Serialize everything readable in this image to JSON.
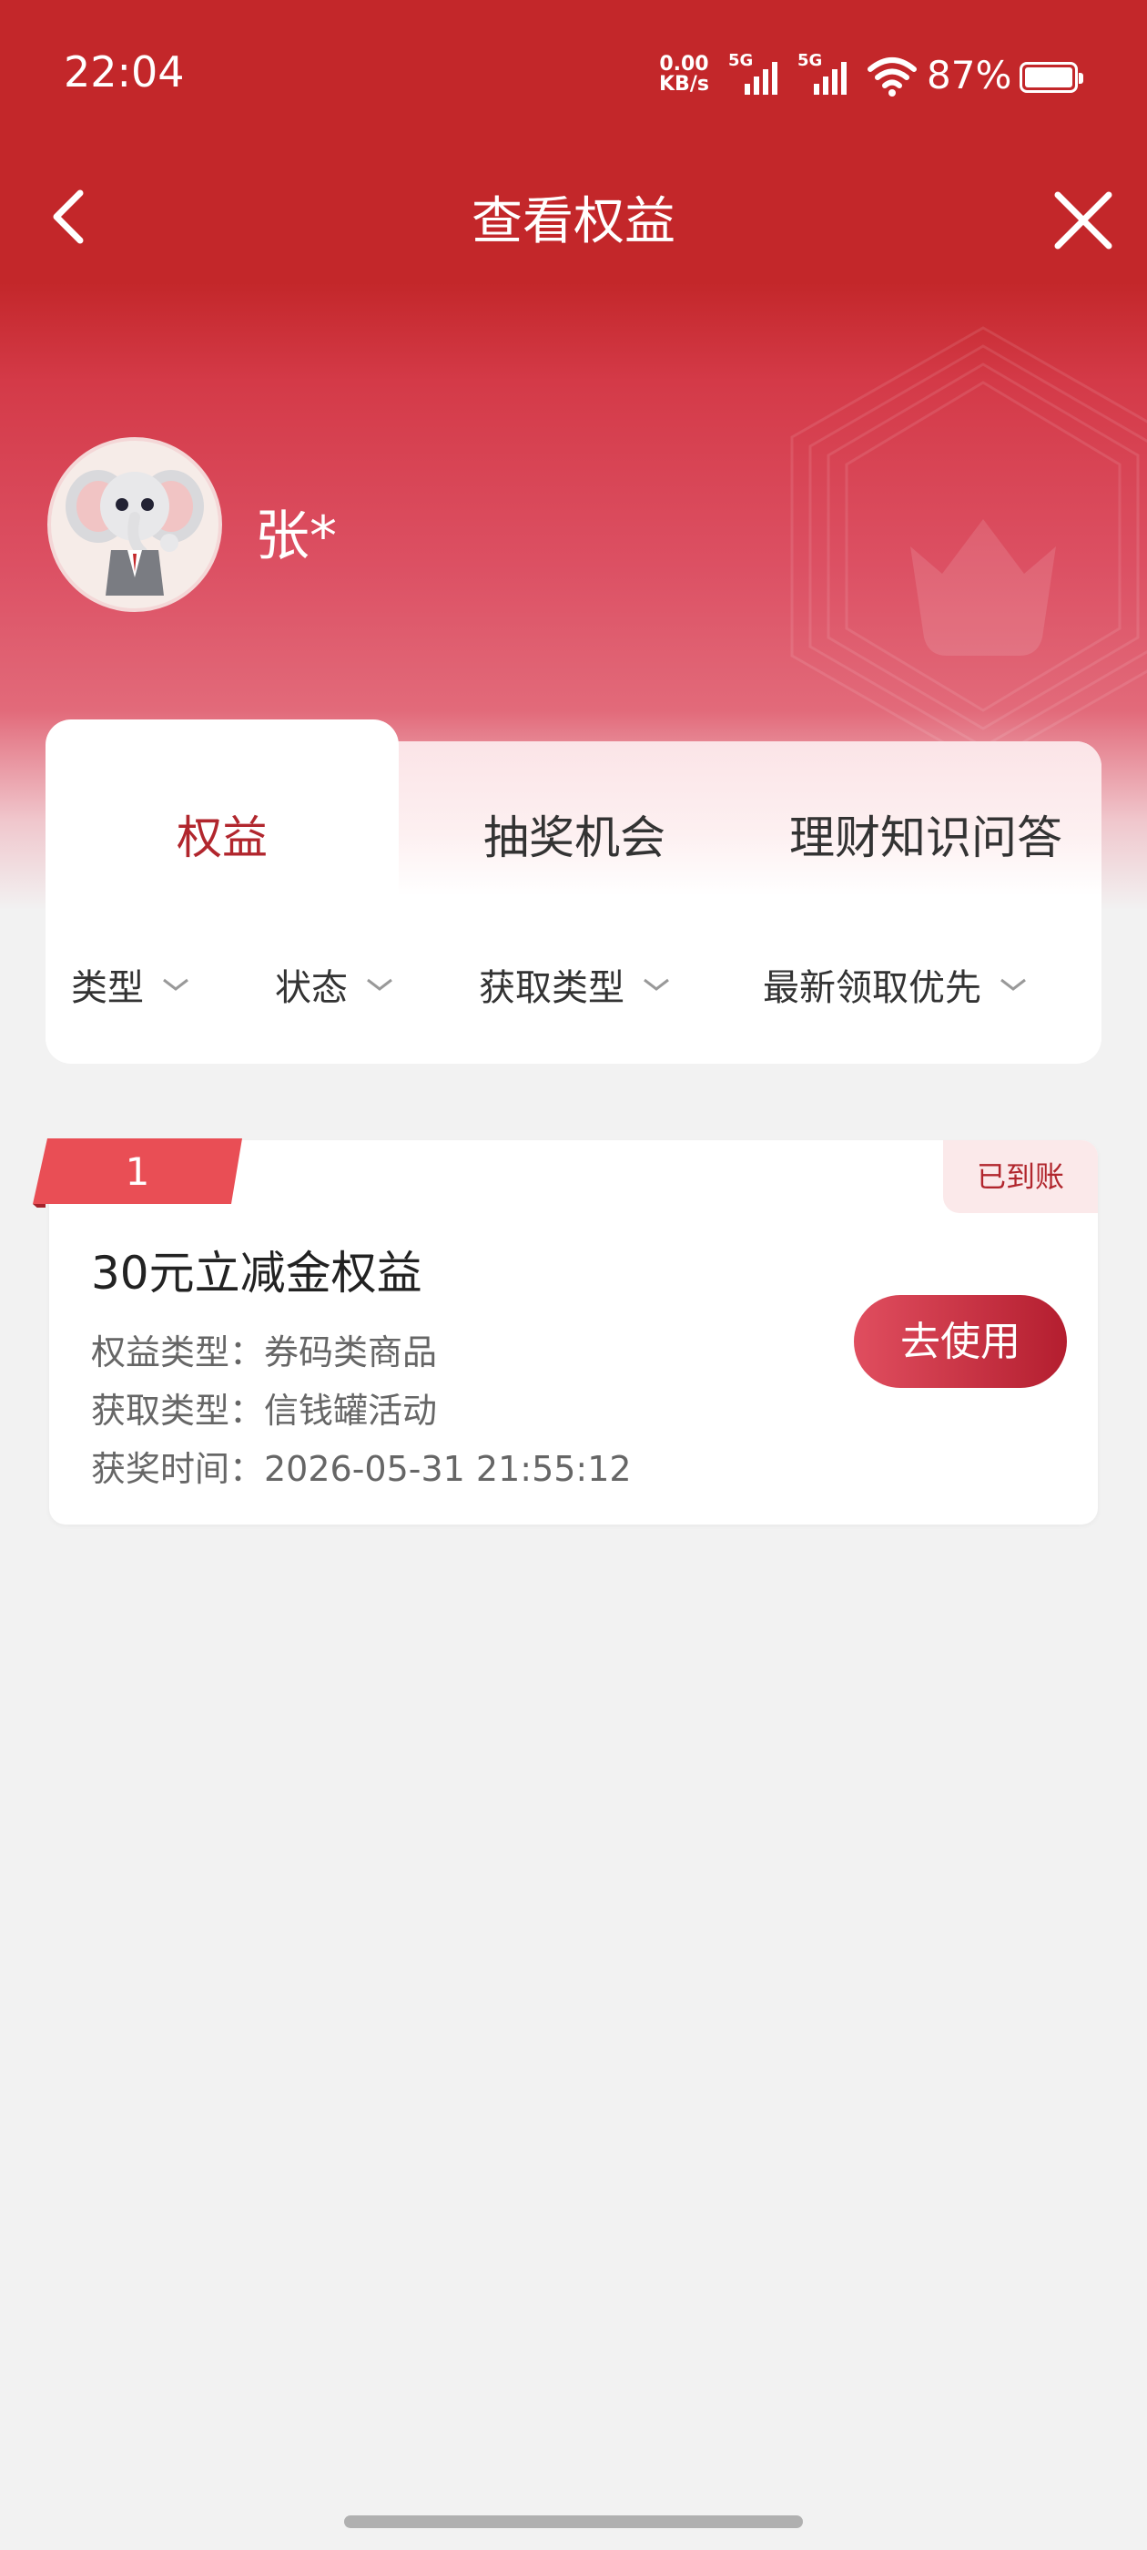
{
  "status_bar": {
    "time": "22:04",
    "net_speed_value": "0.00",
    "net_speed_unit": "KB/s",
    "sim1_label": "5G",
    "sim2_label": "5G",
    "battery": "87%",
    "battery_level": 0.87
  },
  "nav": {
    "title": "查看权益",
    "back_icon": "chevron-left-icon",
    "close_icon": "close-icon"
  },
  "profile": {
    "name": "张*",
    "avatar_icon": "elephant-mascot-avatar"
  },
  "tabs": [
    {
      "label": "权益",
      "active": true
    },
    {
      "label": "抽奖机会",
      "active": false
    },
    {
      "label": "理财知识问答",
      "active": false
    }
  ],
  "filters": [
    {
      "label": "类型"
    },
    {
      "label": "状态"
    },
    {
      "label": "获取类型"
    },
    {
      "label": "最新领取优先"
    }
  ],
  "rewards": [
    {
      "index": "1",
      "status": "已到账",
      "title": "30元立减金权益",
      "type_line": "权益类型：券码类商品",
      "source_line": "获取类型：信钱罐活动",
      "time_line": "获奖时间：2026-05-31 21:55:12",
      "action_label": "去使用"
    }
  ],
  "colors": {
    "brand_red": "#c3272a",
    "active_tab": "#b1262d",
    "page_bg": "#f2f2f2"
  }
}
